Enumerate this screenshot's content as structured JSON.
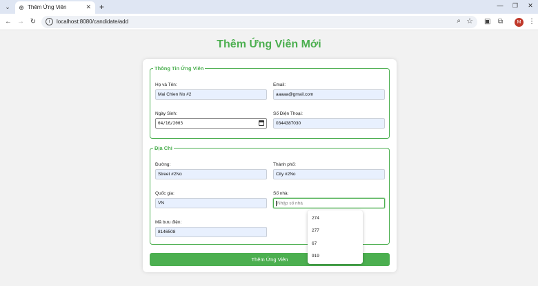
{
  "browser": {
    "tab_title": "Thêm Ứng Viên",
    "tab_close": "✕",
    "new_tab": "+",
    "url": "localhost:8080/candidate/add",
    "avatar_letter": "M"
  },
  "page": {
    "title": "Thêm Ứng Viên Mới",
    "personal_section": {
      "legend": "Thông Tin Ứng Viên",
      "name_label": "Họ và Tên:",
      "name_value": "Mai Chien No #2",
      "email_label": "Email:",
      "email_value": "aaaaa@gmail.com",
      "dob_label": "Ngày Sinh:",
      "dob_value": "04/16/2003",
      "phone_label": "Số Điện Thoại:",
      "phone_value": "0344387030"
    },
    "address_section": {
      "legend": "Địa Chỉ",
      "street_label": "Đường:",
      "street_value": "Street #2No",
      "city_label": "Thành phố:",
      "city_value": "City #2No",
      "country_label": "Quốc gia:",
      "country_value": "VN",
      "number_label": "Số nhà:",
      "number_placeholder": "Nhập số nhà",
      "zip_label": "Mã bưu điện:",
      "zip_value": "8146508"
    },
    "autocomplete_options": [
      "274",
      "277",
      "67",
      "919"
    ],
    "submit_label": "Thêm Ứng Viên"
  },
  "colors": {
    "accent": "#4caf50",
    "input_autofill_bg": "#e8f0fe"
  }
}
